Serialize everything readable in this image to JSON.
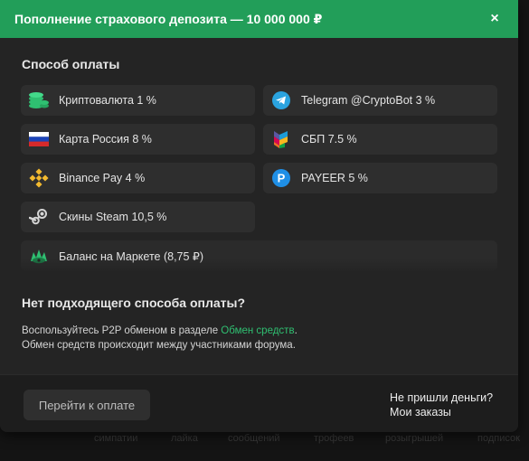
{
  "header": {
    "title": "Пополнение страхового депозита — 10 000 000 ₽",
    "close": "×"
  },
  "payment": {
    "section_title": "Способ оплаты",
    "methods": [
      {
        "label": "Криптовалюта 1 %",
        "icon": "coins-icon"
      },
      {
        "label": "Telegram @CryptoBot 3 %",
        "icon": "telegram-icon"
      },
      {
        "label": "Карта Россия 8 %",
        "icon": "russia-flag-icon"
      },
      {
        "label": "СБП 7.5 %",
        "icon": "sbp-icon"
      },
      {
        "label": "Binance Pay 4 %",
        "icon": "binance-icon"
      },
      {
        "label": "PAYEER 5 %",
        "icon": "payeer-icon"
      },
      {
        "label": "Скины Steam 10,5 %",
        "icon": "steam-icon"
      },
      {
        "label": "Баланс на Маркете (8,75 ₽)",
        "icon": "market-icon"
      }
    ]
  },
  "no_method": {
    "title": "Нет подходящего способа оплаты?",
    "line1_prefix": "Воспользуйтесь P2P обменом в разделе ",
    "line1_link": "Обмен средств",
    "line1_suffix": ".",
    "line2": "Обмен средств происходит между участниками форума."
  },
  "footer": {
    "pay_button": "Перейти к оплате",
    "link_no_money": "Не пришли деньги?",
    "link_orders": "Мои заказы"
  },
  "background": {
    "items": [
      "симпатии",
      "лайка",
      "сообщений",
      "трофеев",
      "розыгрышей",
      "подписок"
    ]
  },
  "colors": {
    "accent": "#229e59",
    "link": "#2fbf71",
    "modal_bg": "#242424"
  }
}
